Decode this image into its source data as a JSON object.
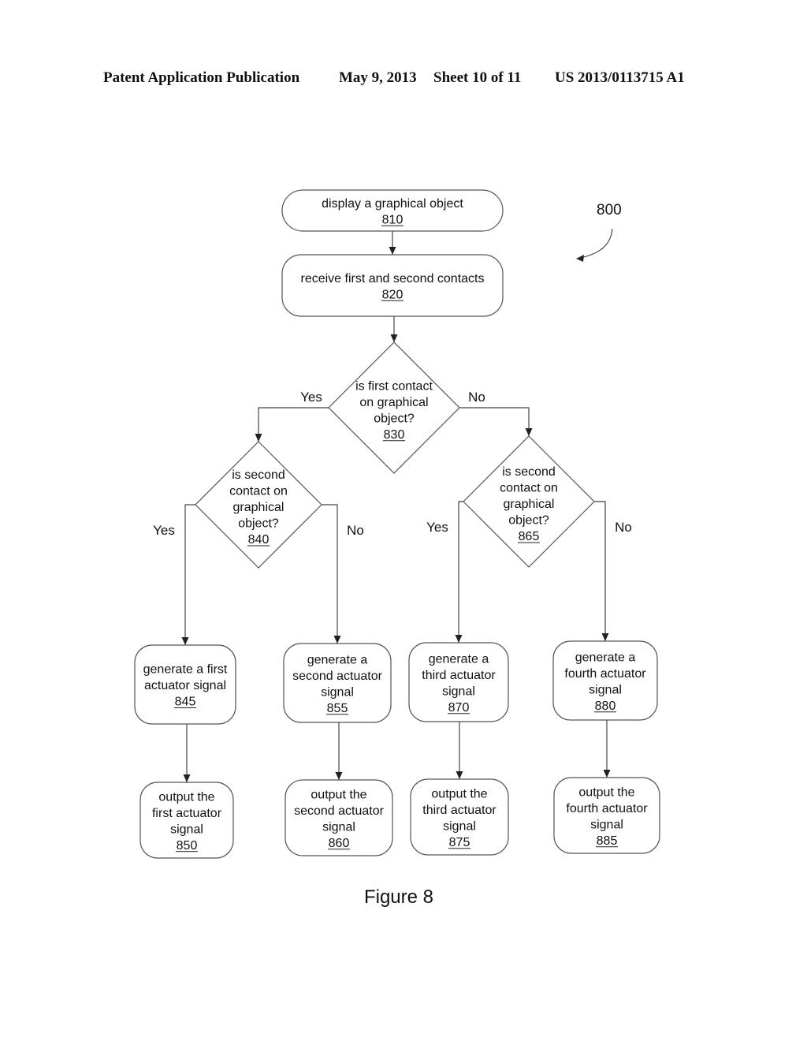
{
  "header": {
    "publication": "Patent Application Publication",
    "date": "May 9, 2013",
    "sheet": "Sheet 10 of 11",
    "number": "US 2013/0113715 A1"
  },
  "figure": {
    "ref_label": "800",
    "caption": "Figure 8"
  },
  "nodes": [
    {
      "id": "810",
      "type": "terminal",
      "lines": [
        "display a graphical object"
      ]
    },
    {
      "id": "820",
      "type": "process",
      "lines": [
        "receive first and second contacts"
      ]
    },
    {
      "id": "830",
      "type": "decision",
      "lines": [
        "is first contact",
        "on graphical",
        "object?"
      ]
    },
    {
      "id": "840",
      "type": "decision",
      "lines": [
        "is second",
        "contact on",
        "graphical",
        "object?"
      ]
    },
    {
      "id": "865",
      "type": "decision",
      "lines": [
        "is second",
        "contact on",
        "graphical",
        "object?"
      ]
    },
    {
      "id": "845",
      "type": "process",
      "lines": [
        "generate a first",
        "actuator signal"
      ]
    },
    {
      "id": "855",
      "type": "process",
      "lines": [
        "generate a",
        "second actuator",
        "signal"
      ]
    },
    {
      "id": "870",
      "type": "process",
      "lines": [
        "generate a",
        "third actuator",
        "signal"
      ]
    },
    {
      "id": "880",
      "type": "process",
      "lines": [
        "generate a",
        "fourth actuator",
        "signal"
      ]
    },
    {
      "id": "850",
      "type": "process",
      "lines": [
        "output the",
        "first actuator",
        "signal"
      ]
    },
    {
      "id": "860",
      "type": "process",
      "lines": [
        "output the",
        "second actuator",
        "signal"
      ]
    },
    {
      "id": "875",
      "type": "process",
      "lines": [
        "output the",
        "third actuator",
        "signal"
      ]
    },
    {
      "id": "885",
      "type": "process",
      "lines": [
        "output the",
        "fourth actuator",
        "signal"
      ]
    }
  ],
  "edges": [
    {
      "from": "810",
      "to": "820",
      "label": ""
    },
    {
      "from": "820",
      "to": "830",
      "label": ""
    },
    {
      "from": "830",
      "to": "840",
      "label": "Yes"
    },
    {
      "from": "830",
      "to": "865",
      "label": "No"
    },
    {
      "from": "840",
      "to": "845",
      "label": "Yes"
    },
    {
      "from": "840",
      "to": "855",
      "label": "No"
    },
    {
      "from": "865",
      "to": "870",
      "label": "Yes"
    },
    {
      "from": "865",
      "to": "880",
      "label": "No"
    },
    {
      "from": "845",
      "to": "850",
      "label": ""
    },
    {
      "from": "855",
      "to": "860",
      "label": ""
    },
    {
      "from": "870",
      "to": "875",
      "label": ""
    },
    {
      "from": "880",
      "to": "885",
      "label": ""
    }
  ]
}
